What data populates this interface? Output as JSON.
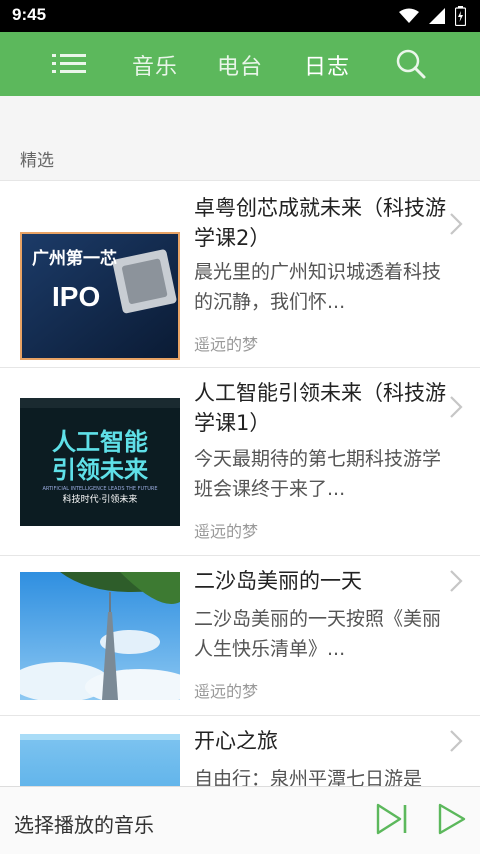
{
  "status_bar": {
    "time": "9:45"
  },
  "nav": {
    "tabs": [
      "音乐",
      "电台",
      "日志"
    ],
    "active_tab": "日志"
  },
  "section": {
    "title": "精选"
  },
  "articles": [
    {
      "title": "卓粤创芯成就未来（科技游学课2）",
      "excerpt": "晨光里的广州知识城透着科技的沉静，我们怀...",
      "author": "遥远的梦",
      "thumb_text": [
        "广州第一芯",
        "IPO"
      ]
    },
    {
      "title": "人工智能引领未来（科技游学课1）",
      "excerpt": "今天最期待的第七期科技游学班会课终于来了...",
      "author": "遥远的梦",
      "thumb_text": [
        "人工智能",
        "引领未来",
        "ARTIFICIAL INTELLIGENCE LEADS THE FUTURE",
        "科技时代·引领未来"
      ]
    },
    {
      "title": "二沙岛美丽的一天",
      "excerpt": "二沙岛美丽的一天按照《美丽人生快乐清单》...",
      "author": "遥远的梦"
    },
    {
      "title": "开心之旅",
      "excerpt": "自由行：泉州平潭七日游是",
      "author": ""
    }
  ],
  "player": {
    "label": "选择播放的音乐"
  },
  "colors": {
    "primary": "#5cb85c",
    "status_bar": "#000000",
    "icon_green": "#5cb85c"
  },
  "icons": [
    "wifi-icon",
    "signal-icon",
    "battery-icon",
    "menu-icon",
    "search-icon",
    "chevron-right-icon",
    "skip-next-icon",
    "play-icon"
  ]
}
